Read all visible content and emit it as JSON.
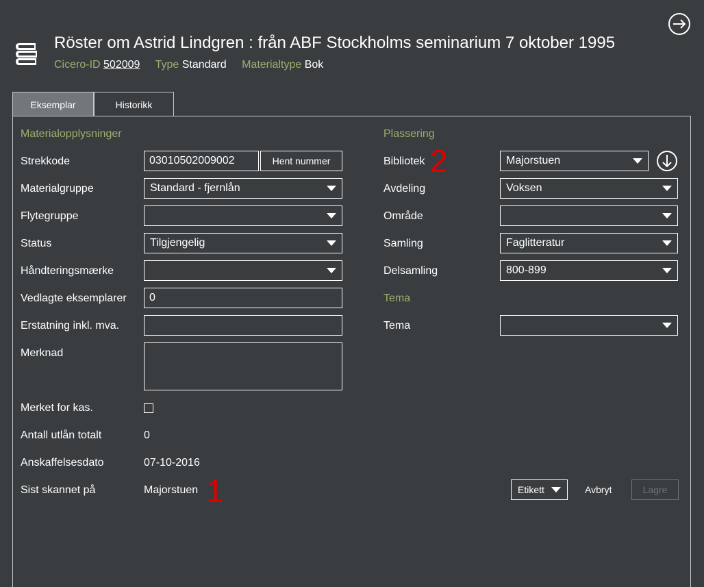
{
  "header": {
    "title": "Röster om Astrid Lindgren : från ABF Stockholms seminarium 7 oktober 1995",
    "cicero_label": "Cicero-ID",
    "cicero_value": "502009",
    "type_label": "Type",
    "type_value": "Standard",
    "materialtype_label": "Materialtype",
    "materialtype_value": "Bok",
    "icons": {
      "book": "book-stack-icon",
      "exit": "exit-arrow-icon"
    }
  },
  "tabs": [
    {
      "label": "Eksemplar",
      "active": true
    },
    {
      "label": "Historikk",
      "active": false
    }
  ],
  "material": {
    "heading": "Materialopplysninger",
    "strekkode_label": "Strekkode",
    "strekkode_value": "03010502009002",
    "hent_button": "Hent nummer",
    "materialgruppe_label": "Materialgruppe",
    "materialgruppe_value": "Standard - fjernlån",
    "flytegruppe_label": "Flytegruppe",
    "flytegruppe_value": "",
    "status_label": "Status",
    "status_value": "Tilgjengelig",
    "handtering_label": "Håndteringsmærke",
    "handtering_value": "",
    "vedlagte_label": "Vedlagte eksemplarer",
    "vedlagte_value": "0",
    "erstatning_label": "Erstatning inkl. mva.",
    "erstatning_value": "",
    "merknad_label": "Merknad",
    "merknad_value": "",
    "kas_label": "Merket for kas.",
    "kas_checked": false,
    "antall_label": "Antall utlån totalt",
    "antall_value": "0",
    "anskaffelse_label": "Anskaffelsesdato",
    "anskaffelse_value": "07-10-2016",
    "sist_label": "Sist skannet på",
    "sist_value": "Majorstuen"
  },
  "placement": {
    "heading": "Plassering",
    "bibliotek_label": "Bibliotek",
    "bibliotek_value": "Majorstuen",
    "avdeling_label": "Avdeling",
    "avdeling_value": "Voksen",
    "omrade_label": "Område",
    "omrade_value": "",
    "samling_label": "Samling",
    "samling_value": "Faglitteratur",
    "delsamling_label": "Delsamling",
    "delsamling_value": "800-899"
  },
  "tema": {
    "heading": "Tema",
    "tema_label": "Tema",
    "tema_value": ""
  },
  "actions": {
    "etikett": "Etikett",
    "avbryt": "Avbryt",
    "lagre": "Lagre"
  },
  "annotations": {
    "marker_1": "1",
    "marker_2": "2",
    "color": "#e00000"
  },
  "colors": {
    "background": "#393d40",
    "accent_label": "#9fae6c",
    "active_tab": "#72777b",
    "border": "#c9c9c9"
  }
}
